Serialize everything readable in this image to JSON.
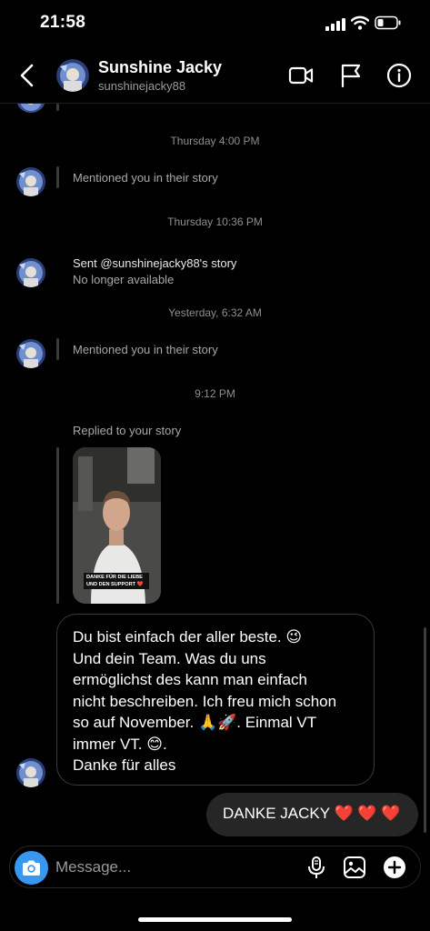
{
  "status_bar": {
    "time": "21:58"
  },
  "header": {
    "name": "Sunshine Jacky",
    "username": "sunshinejacky88",
    "icons": [
      "back-chevron-icon",
      "video-call-icon",
      "flag-icon",
      "info-icon"
    ]
  },
  "thread": {
    "timestamps": [
      "Thursday 4:00 PM",
      "Thursday 10:36 PM",
      "Yesterday, 6:32 AM",
      "9:12 PM"
    ],
    "activity_1": "Mentioned you in their story",
    "activity_2_line1": "Sent @sunshinejacky88's story",
    "activity_2_line2": "No longer available",
    "activity_3": "Mentioned you in their story",
    "replied_label": "Replied to your story",
    "story_caption": "DANKE FÜR DIE LIEBE UND DEN SUPPORT ❤️",
    "incoming_message": "Du bist einfach der aller beste. 😉 Und dein Team. Was du uns ermöglichst des kann man einfach nicht beschreiben. Ich freu mich schon so auf November. 🙏🚀. Einmal VT immer VT. 😊. Danke für alles",
    "incoming_lines": [
      "Du bist einfach der aller beste. 😉",
      "Und dein Team. Was du uns",
      "ermöglichst des kann man einfach",
      "nicht beschreiben. Ich freu mich schon",
      "so auf November. 🙏🚀. Einmal VT",
      "immer VT. 😊.",
      "Danke für alles"
    ],
    "outgoing_text": "DANKE JACKY",
    "outgoing_hearts": "❤️ ❤️ ❤️"
  },
  "composer": {
    "placeholder": "Message...",
    "icons": [
      "camera-icon",
      "microphone-icon",
      "gallery-icon",
      "plus-icon"
    ]
  },
  "colors": {
    "accent": "#3897f0",
    "background": "#000000",
    "bubble_out": "#262626"
  }
}
